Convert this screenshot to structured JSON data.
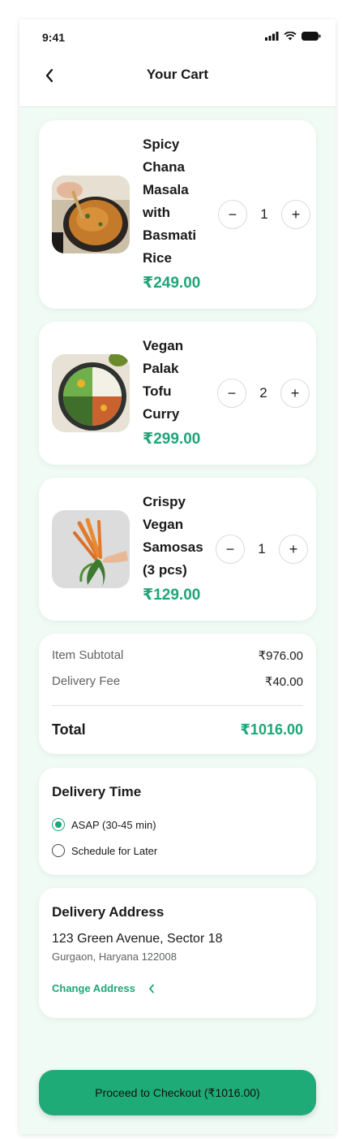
{
  "status_bar": {
    "time": "9:41"
  },
  "header": {
    "title": "Your Cart"
  },
  "items": [
    {
      "name": "Spicy Chana Masala with Basmati Rice",
      "price": "₹249.00",
      "quantity": "1",
      "image": "chana-masala-bowl"
    },
    {
      "name": "Vegan Palak Tofu Curry",
      "price": "₹299.00",
      "quantity": "2",
      "image": "buddha-bowl"
    },
    {
      "name": "Crispy Vegan Samosas (3 pcs)",
      "price": "₹129.00",
      "quantity": "1",
      "image": "carrot-bunch"
    }
  ],
  "summary": {
    "subtotal_label": "Item Subtotal",
    "subtotal": "₹976.00",
    "delivery_label": "Delivery Fee",
    "delivery": "₹40.00",
    "total_label": "Total",
    "total": "₹1016.00"
  },
  "delivery_time": {
    "title": "Delivery Time",
    "options": [
      {
        "label": "ASAP (30-45 min)",
        "selected": true
      },
      {
        "label": "Schedule for Later",
        "selected": false
      }
    ]
  },
  "address": {
    "title": "Delivery Address",
    "line1": "123 Green Avenue, Sector 18",
    "line2": "Gurgaon, Haryana 122008",
    "change_label": "Change Address"
  },
  "checkout": {
    "label": "Proceed to Checkout (₹1016.00)"
  },
  "colors": {
    "accent": "#1fa677",
    "background": "#f0fbf6",
    "button": "#1fab78"
  }
}
